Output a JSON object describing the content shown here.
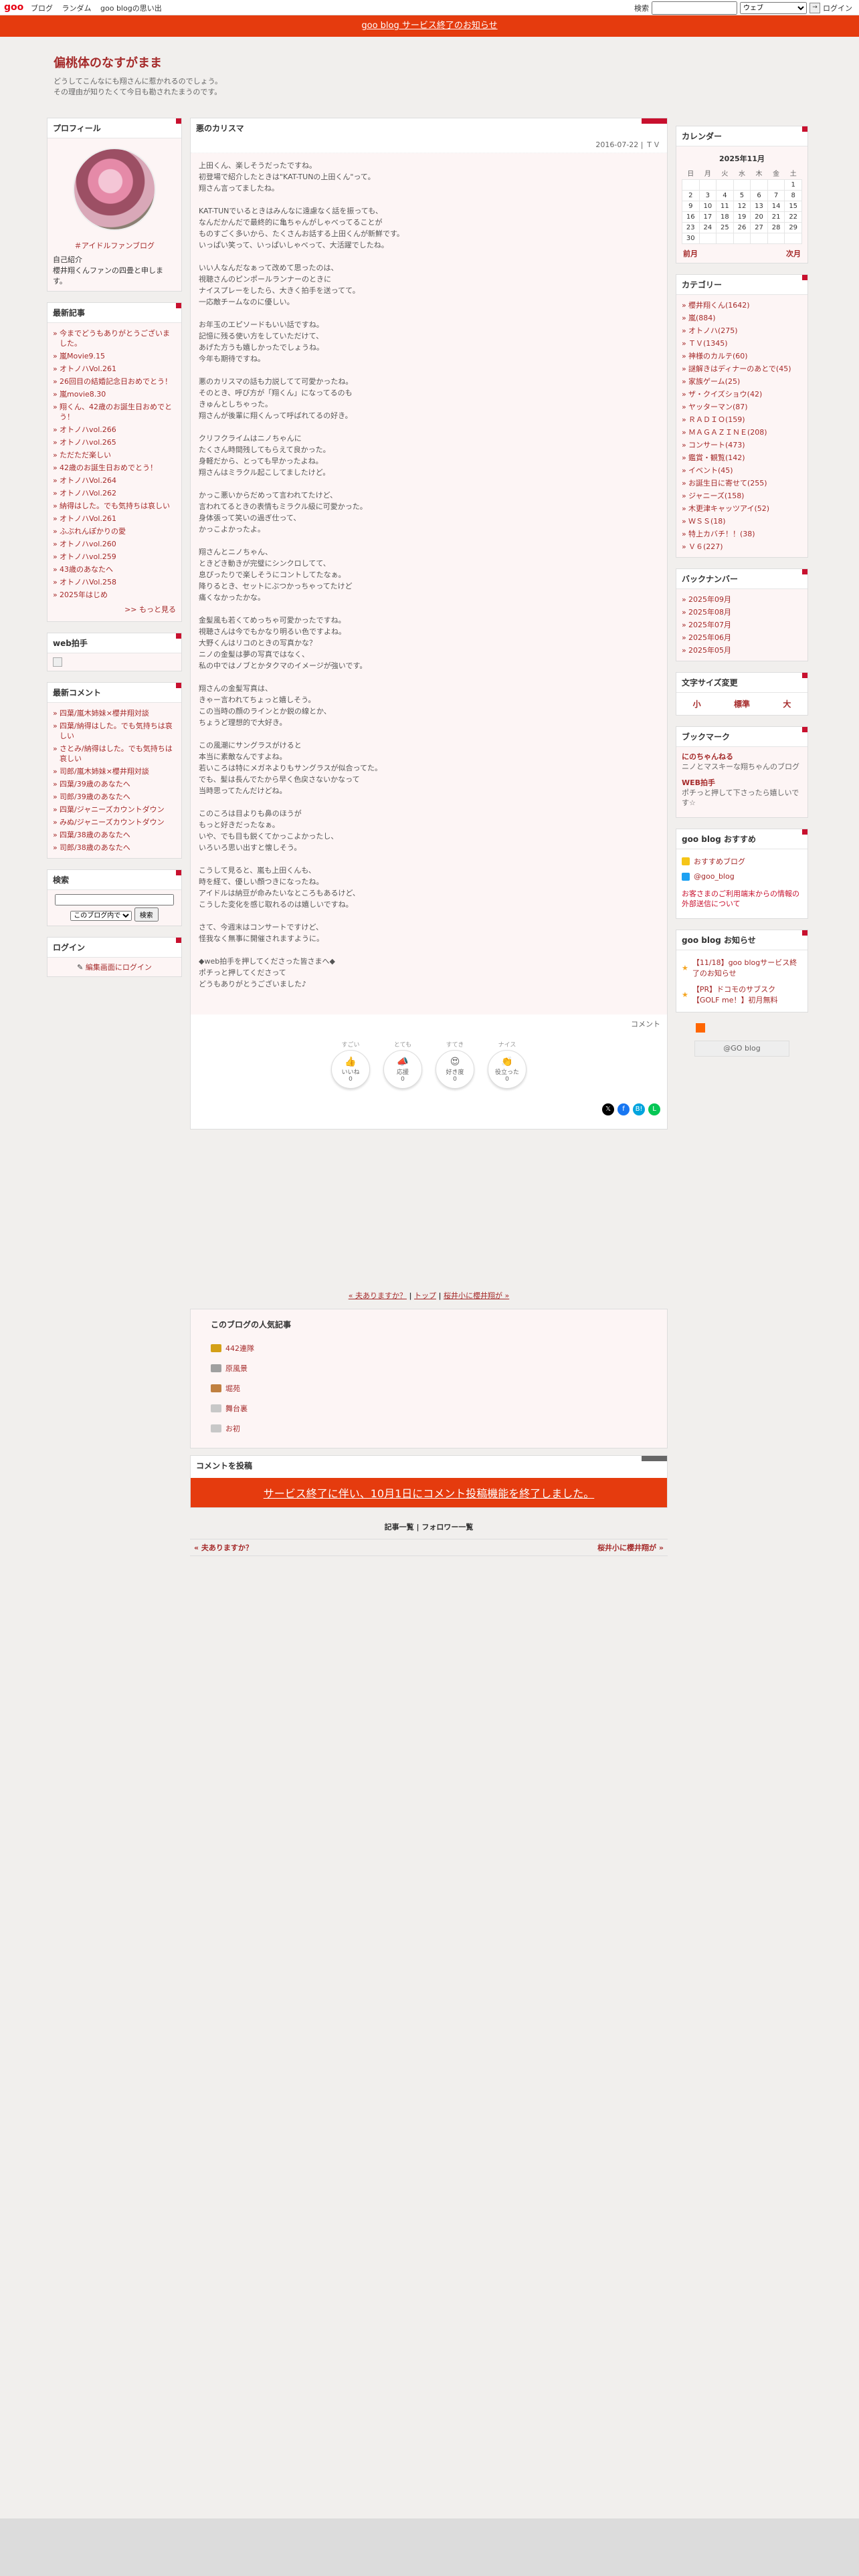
{
  "topbar": {
    "logo": "goo",
    "links": [
      "ブログ",
      "ランダム",
      "goo blogの思い出"
    ],
    "search_label": "検索",
    "search_value": "",
    "search_select": "ウェブ",
    "search_go": "→",
    "login": "ログイン"
  },
  "notice": "goo blog サービス終了のお知らせ",
  "header": {
    "title": "偏桃体のなすがまま",
    "desc1": "どうしてこんなにも翔さんに惹かれるのでしょう。",
    "desc2": "その理由が知りたくて今日も勘されたまうのです。"
  },
  "profile": {
    "title": "プロフィール",
    "link": "＃アイドルファンブログ",
    "intro_title": "自己紹介",
    "intro": "櫻井翔くんファンの四畳と申します。"
  },
  "recent": {
    "title": "最新記事",
    "items": [
      "今までどうもありがとうございました。",
      "嵐Movie9.15",
      "オトノハVol.261",
      "26回目の結婚記念日おめでとう！",
      "嵐movie8.30",
      "翔くん、42歳のお誕生日おめでとう！",
      "オトノハvol.266",
      "オトノハvol.265",
      "ただただ楽しい",
      "42歳のお誕生日おめでとう！",
      "オトノハVol.264",
      "オトノハVol.262",
      "納得はした。でも気持ちは哀しい",
      "オトノハVol.261",
      "ふぶれんぽかりの愛",
      "オトノハvol.260",
      "オトノハvol.259",
      "43歳のあなたへ",
      "オトノハVol.258",
      "2025年はじめ"
    ],
    "more": ">> もっと見る"
  },
  "webclap": {
    "title": "web拍手"
  },
  "comments": {
    "title": "最新コメント",
    "items": [
      "四葉/嵐木姉妹×櫻井翔対談",
      "四葉/納得はした。でも気持ちは哀しい",
      "さとみ/納得はした。でも気持ちは哀しい",
      "司郎/嵐木姉妹×櫻井翔対談",
      "四葉/39歳のあなたへ",
      "司郎/39歳のあなたへ",
      "四葉/ジャニーズカウントダウン",
      "みぬ/ジャニーズカウントダウン",
      "四葉/38歳のあなたへ",
      "司郎/38歳のあなたへ"
    ]
  },
  "search": {
    "title": "検索",
    "select": "このブログ内で",
    "button": "検索"
  },
  "login": {
    "title": "ログイン",
    "link": "編集画面にログイン"
  },
  "article": {
    "title": "悪のカリスマ",
    "date": "2016-07-22",
    "category": "ＴＶ",
    "paragraphs": [
      "上田くん、楽しそうだったですね。\n初登場で紹介したときは\"KAT-TUNの上田くん\"って。\n翔さん言ってましたね。",
      "KAT-TUNでいるときはみんなに遠慮なく話を振っても、\nなんだかんだで最終的に亀ちゃんがしゃべってることが\nものすごく多いから、たくさんお話する上田くんが新鮮です。\nいっぱい笑って、いっぱいしゃべって、大活躍でしたね。",
      "いい人なんだなぁって改めて思ったのは、\n視聴さんのピンポールランナーのときに\nナイスプレーをしたら、大きく拍手を送ってて。\n一応敵チームなのに優しい。",
      "お年玉のエピソードもいい話ですね。\n記憶に残る使い方をしていただけて、\nあげた方うも嬉しかったでしょうね。\n今年も期待ですね。",
      "悪のカリスマの話も力説してて可愛かったね。\nそのとき、呼び方が「翔くん」になってるのも\nきゅんとしちゃった。\n翔さんが後輩に翔くんって呼ばれてるの好き。",
      "クリフクライムはニノちゃんに\nたくさん時間残してもらえて良かった。\n身軽だから、とっても早かったよね。\n翔さんはミラクル起こしてましたけど。",
      "かっこ悪いからだめって言われてたけど、\n言われてるときの表情もミラクル級に可愛かった。\n身体張って笑いの過ぎ仕って、\nかっこよかったよ。",
      "翔さんとニノちゃん、\nときどき動きが完璧にシンクロしてて、\n息ぴったりで楽しそうにコントしてたなぁ。\n降りるとき、セットにぶつかっちゃってたけど\n痛くなかったかな。",
      "金髪風も若くてめっちゃ可愛かったですね。\n視聴さんは今でもかなり明るい色ですよね。\n大野くんはリコのときの写真かな？\nニノの金髪は夢の写真ではなく、\n私の中ではノブとかタクマのイメージが強いです。",
      "翔さんの金髪写真は、\nきゃー言われてちょっと嬉しそう。\nこの当時の顔のラインとか鋭の線とか、\nちょうど理想的で大好き。",
      "この風潮にサングラスがけると\n本当に素敵なんですよね。\n若いころは特にメガネよりもサングラスが似合ってた。\nでも、髪は長んでたから早く色戻さないかなって\n当時思ってたんだけどね。",
      "このころは目よりも鼻のほうが\nもっと好きだったなぁ。\nいや、でも目も鋭くてかっこよかったし、\nいろいろ思い出すと懐しそう。",
      "こうして見ると、嵐も上田くんも、\n時を経て、優しい顔つきになったね。\nアイドルは納豆が命みたいなところもあるけど、\nこうした変化を感じ取れるのは嬉しいですね。",
      "さて、今週末はコンサートですけど、\n怪我なく無事に開催されますように。",
      "◆web拍手を押してくださった皆さまへ◆\nポチっと押してくださって\nどうもありがとうございました♪"
    ],
    "comment_link": "コメント",
    "reactions": [
      {
        "top": "すごい",
        "emoji": "👍",
        "label": "いいね",
        "count": "0"
      },
      {
        "top": "とても",
        "emoji": "📣",
        "label": "応援",
        "count": "0"
      },
      {
        "top": "すてき",
        "emoji": "😍",
        "label": "好き度",
        "count": "0"
      },
      {
        "top": "ナイス",
        "emoji": "👏",
        "label": "役立った",
        "count": "0"
      }
    ],
    "share": [
      {
        "name": "x",
        "glyph": "𝕏",
        "color": "#000000"
      },
      {
        "name": "facebook",
        "glyph": "f",
        "color": "#1877f2"
      },
      {
        "name": "hatena",
        "glyph": "B!",
        "color": "#00a4de"
      },
      {
        "name": "line",
        "glyph": "L",
        "color": "#06c755"
      }
    ]
  },
  "pager": {
    "prev": "« 夫ありますか？",
    "top": "トップ",
    "next": "桜井小に櫻井翔が »",
    "sep": "|"
  },
  "popular": {
    "title": "このブログの人気記事",
    "items": [
      "442連隊",
      "原風景",
      "堀苑",
      "舞台裏",
      "お初"
    ],
    "colors": [
      "#d4a017",
      "#a0a0a0",
      "#c08040",
      "#c8c8c8",
      "#c8c8c8"
    ]
  },
  "post_comment": {
    "title": "コメントを投稿",
    "end": "サービス終了に伴い、10月1日にコメント投稿機能を終了しました。"
  },
  "footer": {
    "links": "記事一覧 | フォロワー一覧",
    "prev": "« 夫ありますか？",
    "next": "桜井小に櫻井翔が »"
  },
  "calendar": {
    "title": "カレンダー",
    "month": "2025年11月",
    "weekdays": [
      "日",
      "月",
      "火",
      "水",
      "木",
      "金",
      "土"
    ],
    "rows": [
      [
        "",
        "",
        "",
        "",
        "",
        "",
        "1"
      ],
      [
        "2",
        "3",
        "4",
        "5",
        "6",
        "7",
        "8"
      ],
      [
        "9",
        "10",
        "11",
        "12",
        "13",
        "14",
        "15"
      ],
      [
        "16",
        "17",
        "18",
        "19",
        "20",
        "21",
        "22"
      ],
      [
        "23",
        "24",
        "25",
        "26",
        "27",
        "28",
        "29"
      ],
      [
        "30",
        "",
        "",
        "",
        "",
        "",
        ""
      ]
    ],
    "prev": "前月",
    "next": "次月"
  },
  "category": {
    "title": "カテゴリー",
    "items": [
      "櫻井翔くん(1642)",
      "嵐(884)",
      "オトノハ(275)",
      "ＴＶ(1345)",
      "神様のカルテ(60)",
      "謎解きはディナーのあとで(45)",
      "家族ゲーム(25)",
      "ザ・クイズショウ(42)",
      "ヤッターマン(87)",
      "ＲＡＤＩＯ(159)",
      "ＭＡＧＡＺＩＮＥ(208)",
      "コンサート(473)",
      "鑑賞・観覧(142)",
      "イベント(45)",
      "お誕生日に寄せて(255)",
      "ジャニーズ(158)",
      "木更津キャッツアイ(52)",
      "ＷＳＳ(18)",
      "特上カバチ！！(38)",
      "Ｖ６(227)"
    ]
  },
  "backnumber": {
    "title": "バックナンバー",
    "items": [
      "2025年09月",
      "2025年08月",
      "2025年07月",
      "2025年06月",
      "2025年05月"
    ]
  },
  "fontsize": {
    "title": "文字サイズ変更",
    "small": "小",
    "normal": "標準",
    "large": "大"
  },
  "bookmark": {
    "title": "ブックマーク",
    "item1_title": "にのちゃんねる",
    "item1_desc": "ニノとマスキーな翔ちゃんのブログ",
    "item2_title": "WEB拍手",
    "item2_desc": "ポチっと押して下さったら嬉しいです☆"
  },
  "goo_recommend": {
    "title": "goo blog おすすめ",
    "item1": "おすすめブログ",
    "item2": "@goo_blog",
    "info": "お客さまのご利用端末からの情報の外部送信について"
  },
  "goo_notice": {
    "title": "goo blog お知らせ",
    "items": [
      "【11/18】goo blogサービス終了のお知らせ",
      "【PR】ドコモのサブスク【GOLF me！】初月無料"
    ]
  },
  "badge": "@GO blog"
}
